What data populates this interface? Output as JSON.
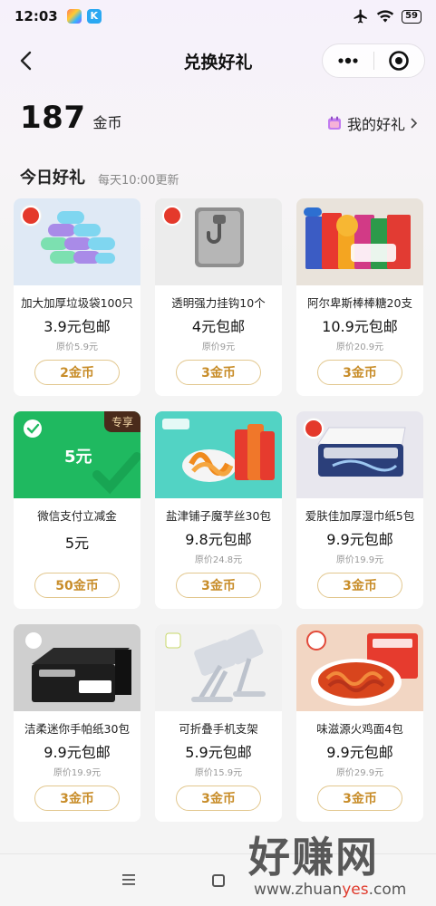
{
  "status_bar": {
    "time": "12:03",
    "battery": "59",
    "icons": [
      "gallery-app-icon",
      "k-app-icon",
      "airplane-icon",
      "wifi-icon",
      "battery-icon"
    ]
  },
  "nav": {
    "title": "兑换好礼"
  },
  "balance": {
    "amount": "187",
    "unit": "金币",
    "my_gifts_label": "我的好礼"
  },
  "section": {
    "title": "今日好礼",
    "subtitle": "每天10:00更新"
  },
  "items": [
    {
      "name": "加大加厚垃圾袋100只",
      "price": "3.9元包邮",
      "original": "原价5.9元",
      "cost": "2金币",
      "bg": "#dfe9f5",
      "badge": "shrimp"
    },
    {
      "name": "透明强力挂钩10个",
      "price": "4元包邮",
      "original": "原价9元",
      "cost": "3金币",
      "bg": "#ececec",
      "badge": "shrimp"
    },
    {
      "name": "阿尔卑斯棒棒糖20支",
      "price": "10.9元包邮",
      "original": "原价20.9元",
      "cost": "3金币",
      "bg": "#e9e3db",
      "badge": ""
    },
    {
      "name": "微信支付立减金",
      "price": "5元",
      "original": "",
      "cost": "50金币",
      "bg": "#1fb960",
      "badge": "exclusive",
      "badge_text": "专享",
      "voucher_text": "5元"
    },
    {
      "name": "盐津铺子魔芋丝30包",
      "price": "9.8元包邮",
      "original": "原价24.8元",
      "cost": "3金币",
      "bg": "#52d3c4",
      "badge": ""
    },
    {
      "name": "爱肤佳加厚湿巾纸5包",
      "price": "9.9元包邮",
      "original": "原价19.9元",
      "cost": "3金币",
      "bg": "#e8e7ee",
      "badge": "shrimp"
    },
    {
      "name": "洁柔迷你手帕纸30包",
      "price": "9.9元包邮",
      "original": "原价19.9元",
      "cost": "3金币",
      "bg": "#cfcfcf",
      "badge": ""
    },
    {
      "name": "可折叠手机支架",
      "price": "5.9元包邮",
      "original": "原价15.9元",
      "cost": "3金币",
      "bg": "#f1f1f1",
      "badge": ""
    },
    {
      "name": "味滋源火鸡面4包",
      "price": "9.9元包邮",
      "original": "原价29.9元",
      "cost": "3金币",
      "bg": "#f2d6c3",
      "badge": ""
    }
  ],
  "watermark": {
    "big": "好赚网",
    "small_prefix": "www.zhuan",
    "small_highlight": "yes",
    "small_suffix": ".com"
  },
  "colors": {
    "coin_button_text": "#c88d2a",
    "coin_button_border": "#e2c78e",
    "shrimp_badge": "#e4392b",
    "exclusive_badge": "#4a2b1b"
  }
}
